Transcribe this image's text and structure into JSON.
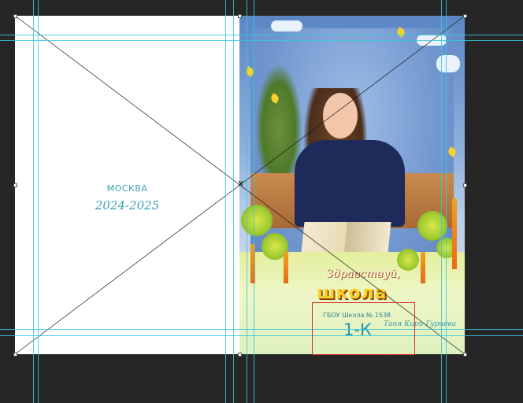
{
  "left_page": {
    "city": "МОСКВА",
    "years": "2024-2025"
  },
  "cover": {
    "greeting": "Здравствуй,",
    "title": "школа",
    "school_number": "ГБОУ Школа № 1538",
    "class_name": "1-К",
    "student_name": "Таня Кири-Гуриева"
  },
  "colors": {
    "workspace": "#262626",
    "guides": "#37c7e0",
    "selection": "#d62b2b",
    "accent_text": "#3b9fb3"
  }
}
